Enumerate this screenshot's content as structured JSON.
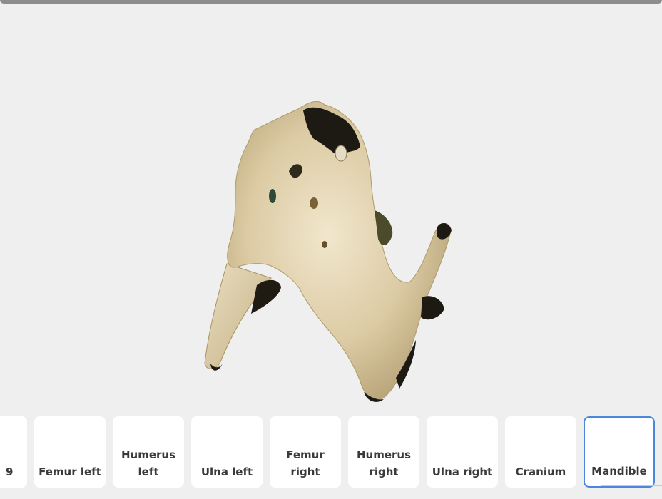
{
  "viewer": {
    "model_name": "Mandible"
  },
  "gallery": {
    "items": [
      {
        "label": "9",
        "selected": false
      },
      {
        "label": "Femur left",
        "selected": false
      },
      {
        "label": "Humerus left",
        "selected": false
      },
      {
        "label": "Ulna left",
        "selected": false
      },
      {
        "label": "Femur right",
        "selected": false
      },
      {
        "label": "Humerus right",
        "selected": false
      },
      {
        "label": "Ulna right",
        "selected": false
      },
      {
        "label": "Cranium",
        "selected": false
      },
      {
        "label": "Mandible",
        "selected": true
      }
    ]
  },
  "colors": {
    "background": "#efefef",
    "card": "#ffffff",
    "selected_border": "#4a88e0",
    "bone": "#d8c8a2"
  }
}
